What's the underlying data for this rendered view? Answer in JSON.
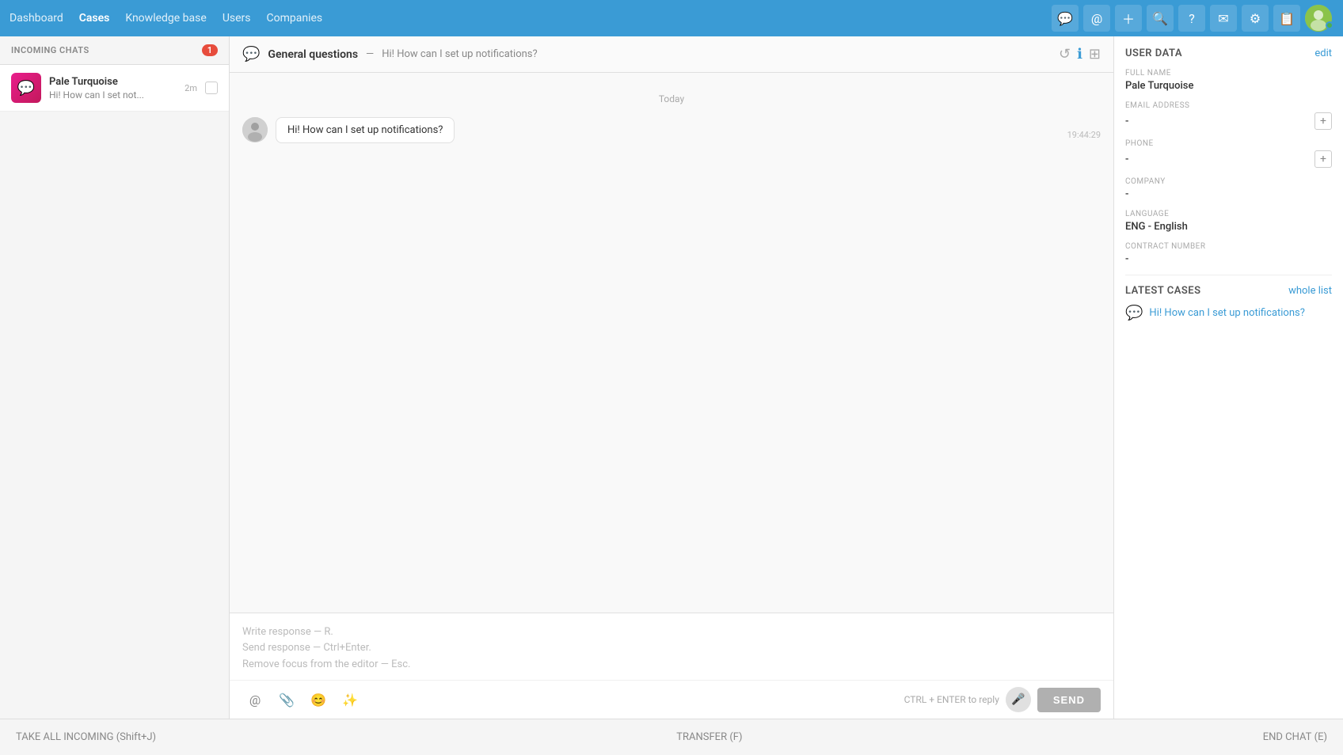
{
  "nav": {
    "items": [
      {
        "label": "Dashboard",
        "active": false
      },
      {
        "label": "Cases",
        "active": true
      },
      {
        "label": "Knowledge base",
        "active": false
      },
      {
        "label": "Users",
        "active": false
      },
      {
        "label": "Companies",
        "active": false
      }
    ],
    "icons": [
      "chat-icon",
      "at-icon",
      "plus-icon",
      "search-icon",
      "question-icon",
      "message-icon",
      "gear-icon",
      "email-icon"
    ]
  },
  "sidebar": {
    "section_title": "INCOMING CHATS",
    "badge_count": "1",
    "chats": [
      {
        "name": "Pale Turquoise",
        "preview": "Hi! How can I set not...",
        "time": "2m",
        "avatar_color": "#c2185b"
      }
    ]
  },
  "chat": {
    "header": {
      "category": "General questions",
      "separator": "—",
      "message": "Hi! How can I set up notifications?",
      "icons": [
        "history-icon",
        "info-icon",
        "add-icon"
      ]
    },
    "date_label": "Today",
    "messages": [
      {
        "text": "Hi! How can I set up notifications?",
        "time": "19:44:29",
        "sender": "user"
      }
    ],
    "reply": {
      "placeholder_line1": "Write response — R.",
      "placeholder_line2": "Send response — Ctrl+Enter.",
      "placeholder_line3": "Remove focus from the editor — Esc.",
      "hint": "CTRL + ENTER to reply",
      "send_label": "SEND"
    }
  },
  "right_panel": {
    "user_data_title": "USER DATA",
    "edit_label": "edit",
    "fields": [
      {
        "label": "FULL NAME",
        "value": "Pale Turquoise",
        "has_add": false
      },
      {
        "label": "EMAIL ADDRESS",
        "value": "-",
        "has_add": true
      },
      {
        "label": "PHONE",
        "value": "-",
        "has_add": true
      },
      {
        "label": "COMPANY",
        "value": "-",
        "has_add": false
      },
      {
        "label": "LANGUAGE",
        "value": "ENG - English",
        "has_add": false
      },
      {
        "label": "CONTRACT NUMBER",
        "value": "-",
        "has_add": false
      }
    ],
    "latest_cases_title": "LATEST CASES",
    "whole_list_label": "whole list",
    "cases": [
      {
        "title": "Hi! How can I set up notifications?"
      }
    ]
  },
  "bottom_bar": {
    "take_all_label": "TAKE ALL INCOMING",
    "take_all_shortcut": "(Shift+J)",
    "transfer_label": "TRANSFER",
    "transfer_shortcut": "(F)",
    "end_chat_label": "END CHAT",
    "end_chat_shortcut": "(E)"
  }
}
